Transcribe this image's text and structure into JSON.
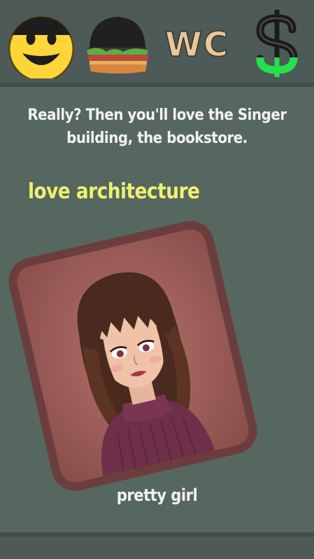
{
  "stats": {
    "mood_icon": "smiley-face-icon",
    "food_icon": "burger-icon",
    "toilet_label": "WC",
    "money_icon": "dollar-icon",
    "colors": {
      "mood_full": "#ffd53a",
      "mood_empty": "#1d1d1d",
      "food": "#202020",
      "toilet": "#e7c79a",
      "money_full": "#25e04a",
      "money_empty": "#1b1b1b"
    }
  },
  "dialog": {
    "message": "Really? Then you'll love the Singer building, the bookstore.",
    "choice": "love architecture"
  },
  "card": {
    "label": "pretty girl",
    "image_icon": "pretty-girl-portrait",
    "colors": {
      "frame": "#6b3e3d",
      "background": "#9c5d59"
    }
  }
}
